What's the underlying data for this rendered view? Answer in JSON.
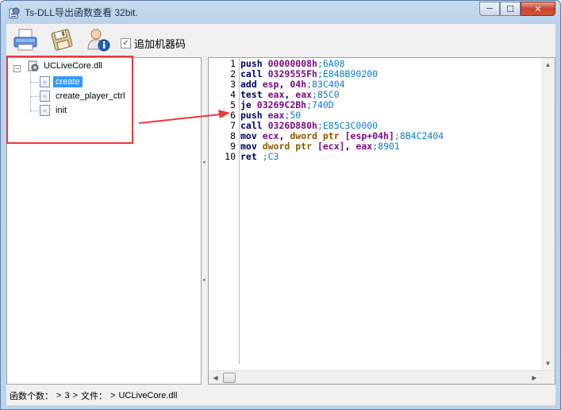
{
  "window": {
    "title": "Ts-DLL导出函数查看 32bit.",
    "minimize_glyph": "─",
    "maximize_glyph": "☐",
    "close_glyph": "✕"
  },
  "toolbar": {
    "buttons": [
      {
        "icon": "printer-icon"
      },
      {
        "icon": "save-disk-icon"
      },
      {
        "icon": "user-info-icon"
      }
    ],
    "checkbox": {
      "label": "追加机器码",
      "checked": true,
      "check_glyph": "✓"
    }
  },
  "tree": {
    "expander_glyph": "−",
    "root": {
      "label": "UCLiveCore.dll",
      "icon": "dll-file-icon"
    },
    "functions": [
      {
        "label": "create",
        "selected": true,
        "icon": "function-icon"
      },
      {
        "label": "create_player_ctrl",
        "selected": false,
        "icon": "function-icon"
      },
      {
        "label": "init",
        "selected": false,
        "icon": "function-icon"
      }
    ],
    "fn_icon_glyph": "‹›"
  },
  "code": {
    "lines": [
      {
        "n": "1",
        "mn": "push ",
        "ops": [
          {
            "t": "00000008h",
            "c": "num"
          }
        ],
        "hex": ";6A08"
      },
      {
        "n": "2",
        "mn": "call ",
        "ops": [
          {
            "t": "0329555Fh",
            "c": "num"
          }
        ],
        "hex": ";E848B90200"
      },
      {
        "n": "3",
        "mn": "add ",
        "ops": [
          {
            "t": "esp",
            "c": "reg"
          },
          {
            "t": ", ",
            "c": "plain"
          },
          {
            "t": "04h",
            "c": "num"
          }
        ],
        "hex": ";83C404"
      },
      {
        "n": "4",
        "mn": "test ",
        "ops": [
          {
            "t": "eax",
            "c": "reg"
          },
          {
            "t": ", ",
            "c": "plain"
          },
          {
            "t": "eax",
            "c": "reg"
          }
        ],
        "hex": ";85C0"
      },
      {
        "n": "5",
        "mn": "je ",
        "ops": [
          {
            "t": "03269C2Bh",
            "c": "num"
          }
        ],
        "hex": ";740D"
      },
      {
        "n": "6",
        "mn": "push ",
        "ops": [
          {
            "t": "eax",
            "c": "reg"
          }
        ],
        "hex": ";50"
      },
      {
        "n": "7",
        "mn": "call ",
        "ops": [
          {
            "t": "0326D880h",
            "c": "num"
          }
        ],
        "hex": ";E85C3C0000"
      },
      {
        "n": "8",
        "mn": "mov ",
        "ops": [
          {
            "t": "ecx",
            "c": "reg"
          },
          {
            "t": ", ",
            "c": "plain"
          },
          {
            "t": "dword ptr ",
            "c": "kw"
          },
          {
            "t": "[esp+04h]",
            "c": "reg"
          }
        ],
        "hex": ";8B4C2404"
      },
      {
        "n": "9",
        "mn": "mov ",
        "ops": [
          {
            "t": "dword ptr ",
            "c": "kw"
          },
          {
            "t": "[ecx]",
            "c": "reg"
          },
          {
            "t": ", ",
            "c": "plain"
          },
          {
            "t": "eax",
            "c": "reg"
          }
        ],
        "hex": ";8901"
      },
      {
        "n": "10",
        "mn": "ret ",
        "ops": [],
        "hex": ";C3"
      }
    ]
  },
  "scrollbars": {
    "left_glyph": "◀",
    "right_glyph": "▶",
    "up_glyph": "▲",
    "down_glyph": "▼",
    "splitter_glyph": "◂"
  },
  "status": {
    "label": "函数个数：",
    "sep": ">",
    "count": "3",
    "file_label": "文件：",
    "file": "UCLiveCore.dll"
  },
  "colors": {
    "selection": "#3399ff",
    "annotation_red": "#e8393a",
    "mnemonic": "#00006e",
    "number": "#7d0a86",
    "keyword": "#8c5a00",
    "machine_code": "#0a7bd0"
  }
}
